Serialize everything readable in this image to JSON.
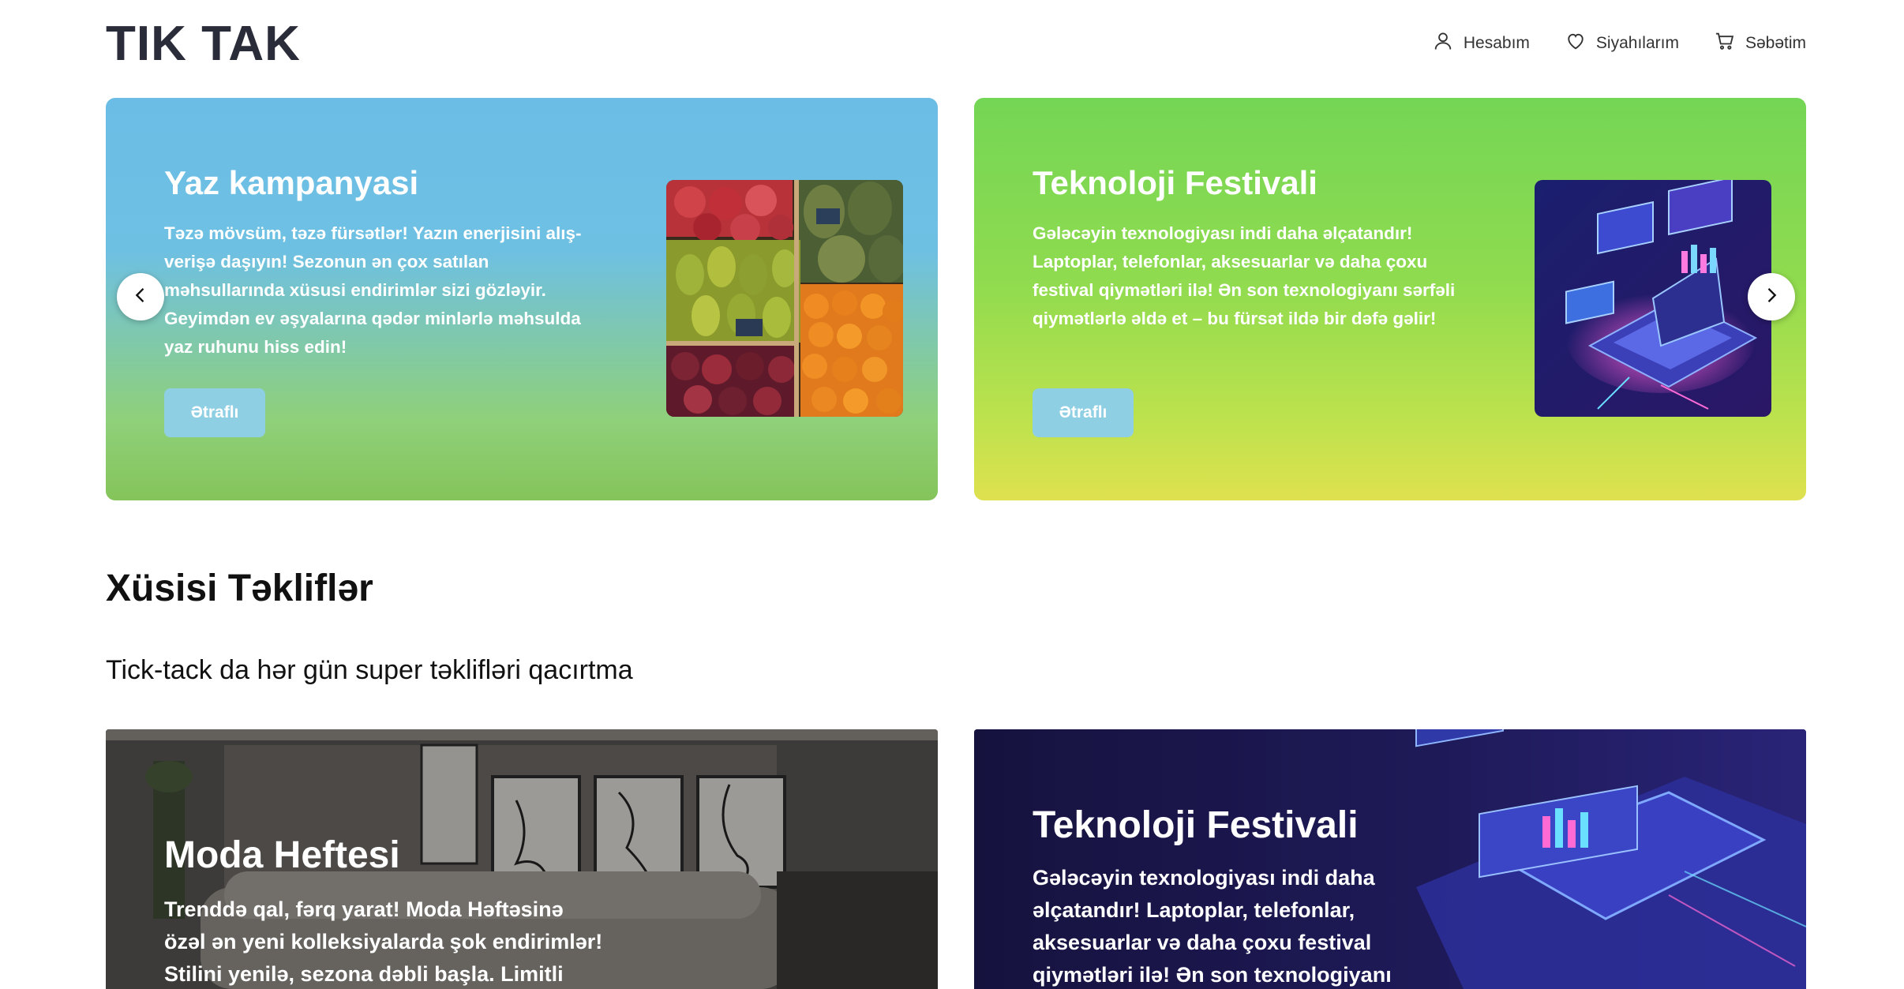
{
  "header": {
    "logo": "TIK TAK",
    "nav": [
      {
        "label": "Hesabım",
        "icon": "user-icon"
      },
      {
        "label": "Siyahılarım",
        "icon": "heart-icon"
      },
      {
        "label": "Səbətim",
        "icon": "cart-icon"
      }
    ]
  },
  "slider": {
    "slides": [
      {
        "title": "Yaz kampanyasi",
        "text": "Təzə mövsüm, təzə fürsətlər! Yazın enerjisini alış-verişə daşıyın! Sezonun ən çox satılan məhsullarında xüsusi endirimlər sizi gözləyir. Geyimdən ev əşyalarına qədər minlərlə məhsulda yaz ruhunu hiss edin!",
        "button": "Ətraflı",
        "image": "fruit-market-image"
      },
      {
        "title": "Teknoloji Festivali",
        "text": "Gələcəyin texnologiyası indi daha əlçatandır! Laptoplar, telefonlar, aksesuarlar və daha çoxu festival qiymətləri ilə! Ən son texnologiyanı sərfəli qiymətlərlə əldə et – bu fürsət ildə bir dəfə gəlir!",
        "button": "Ətraflı",
        "image": "tech-laptop-image"
      }
    ],
    "prev_icon": "chevron-left-icon",
    "next_icon": "chevron-right-icon"
  },
  "offers": {
    "title": "Xüsisi Təkliflər",
    "subtitle": "Tick-tack da hər gün super təklifləri qacırtma",
    "cards": [
      {
        "title": "Moda Heftesi",
        "text": "Trenddə qal, fərq yarat! Moda Həftəsinə özəl ən yeni kolleksiyalarda şok endirimlər! Stilini yenilə, sezona dəbli başla. Limitli"
      },
      {
        "title": "Teknoloji Festivali",
        "text": "Gələcəyin texnologiyası indi daha əlçatandır! Laptoplar, telefonlar, aksesuarlar və daha çoxu festival qiymətləri ilə! Ən son texnologiyanı sərfəli"
      }
    ]
  },
  "colors": {
    "logo": "#2a2c3a",
    "button": "#8fcfe4",
    "slide1_top": "#6bbde6",
    "slide1_bottom": "#85c45a",
    "slide2_top": "#74d655",
    "slide2_bottom": "#dfe14f",
    "card2_bg": "#1b1645"
  }
}
